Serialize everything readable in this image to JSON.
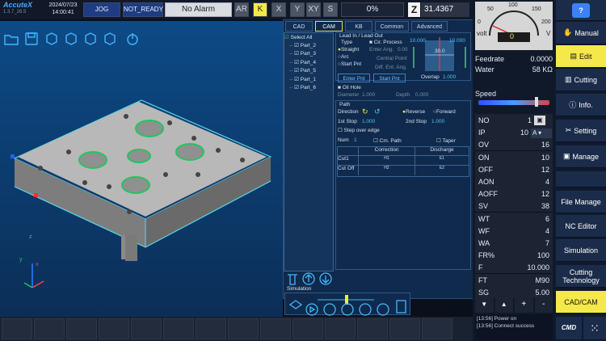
{
  "header": {
    "logo": "AccuteX",
    "version": "1.3.7_26.5",
    "date": "2024/07/23",
    "time": "14:00:41",
    "mode": "JOG",
    "state": "NOT_READY",
    "alarm": "No Alarm",
    "axis_buttons": [
      "AR",
      "K",
      "X",
      "Y",
      "XY",
      "S"
    ],
    "active_axis": "K",
    "percent": "0%",
    "z_label": "Z",
    "z_value": "31.4367"
  },
  "viewport": {
    "axis_x": "x",
    "axis_y": "y",
    "axis_z": "z"
  },
  "panel": {
    "tabs": [
      "CAD",
      "CAM",
      "KB",
      "Common",
      "Advanced"
    ],
    "active_tab": "CAM",
    "select_all": "Select All",
    "parts": [
      "Part_2",
      "Part_3",
      "Part_4",
      "Part_5",
      "Part_1",
      "Part_6"
    ],
    "lead_title": "Lead In / Lead Out",
    "type_label": "Type",
    "types": [
      "Straight",
      "Arc",
      "Start Pnt"
    ],
    "cir_process": "Cir. Process",
    "enter_ang": "Enter Ang.",
    "enter_ang_val": "0.00",
    "central_point": "Central Point",
    "diff_ang": "Diff. Ent. Ang.",
    "enter_pnt": "Enter Pnt",
    "start_pnt": "Start Pnt",
    "dim_left": "10.000",
    "dim_right": "10.000",
    "dim_mid": "30.0",
    "overlap_label": "Overlap",
    "overlap_val": "1.000",
    "oil_hole": "Oil Hole",
    "diameter_label": "Diameter",
    "diameter_val": "1.000",
    "depth_label": "Depth",
    "depth_val": "0.000",
    "path": "Path",
    "direction": "Direction",
    "reverse": "Reverse",
    "forward": "Forward",
    "stop1_label": "1st Stop",
    "stop1_val": "1.000",
    "stop2_label": "2nd Stop",
    "stop2_val": "1.000",
    "step_over": "Step over edge",
    "num_label": "Num",
    "num_val": "1",
    "cm_path": "Cm. Path",
    "taper": "Taper",
    "table_headers": [
      "",
      "Correction",
      "Discharge"
    ],
    "table_rows": [
      [
        "Cut1",
        "H1",
        "E1"
      ],
      [
        "Cut Off",
        "H2",
        "E2"
      ]
    ],
    "simulation": "Simulation"
  },
  "gauge": {
    "ticks": [
      "0",
      "50",
      "100",
      "150",
      "200"
    ],
    "left": "volt",
    "right": "V",
    "value": "0"
  },
  "readouts": [
    {
      "label": "Feedrate",
      "value": "0.0000"
    },
    {
      "label": "Water",
      "value": "58 KΩ"
    }
  ],
  "speed_label": "Speed",
  "params": [
    {
      "k": "NO",
      "v": "1"
    },
    {
      "k": "IP",
      "v": "10"
    },
    {
      "k": "OV",
      "v": "16"
    },
    {
      "k": "ON",
      "v": "10"
    },
    {
      "k": "OFF",
      "v": "12"
    },
    {
      "k": "AON",
      "v": "4"
    },
    {
      "k": "AOFF",
      "v": "12"
    },
    {
      "k": "SV",
      "v": "38"
    },
    {
      "k": "WT",
      "v": "6"
    },
    {
      "k": "WF",
      "v": "4"
    },
    {
      "k": "WA",
      "v": "7"
    },
    {
      "k": "FR%",
      "v": "100"
    },
    {
      "k": "F",
      "v": "10.000"
    },
    {
      "k": "FT",
      "v": "M90"
    },
    {
      "k": "SG",
      "v": "5.00"
    }
  ],
  "ip_unit": "A",
  "log": [
    "[13:56] Power on",
    "[13:56] Connect success"
  ],
  "side_buttons": [
    "Manual",
    "Edit",
    "Cutting",
    "Info.",
    "Setting",
    "Manage",
    "File Manage",
    "NC Editor",
    "Simulation",
    "Cutting Technology",
    "CAD/CAM"
  ],
  "cmd_label": "CMD",
  "colors": {
    "accent": "#f5e84a",
    "cyan": "#4fc3f7",
    "part": "#bdbdbd",
    "highlight": "#22c55e"
  }
}
